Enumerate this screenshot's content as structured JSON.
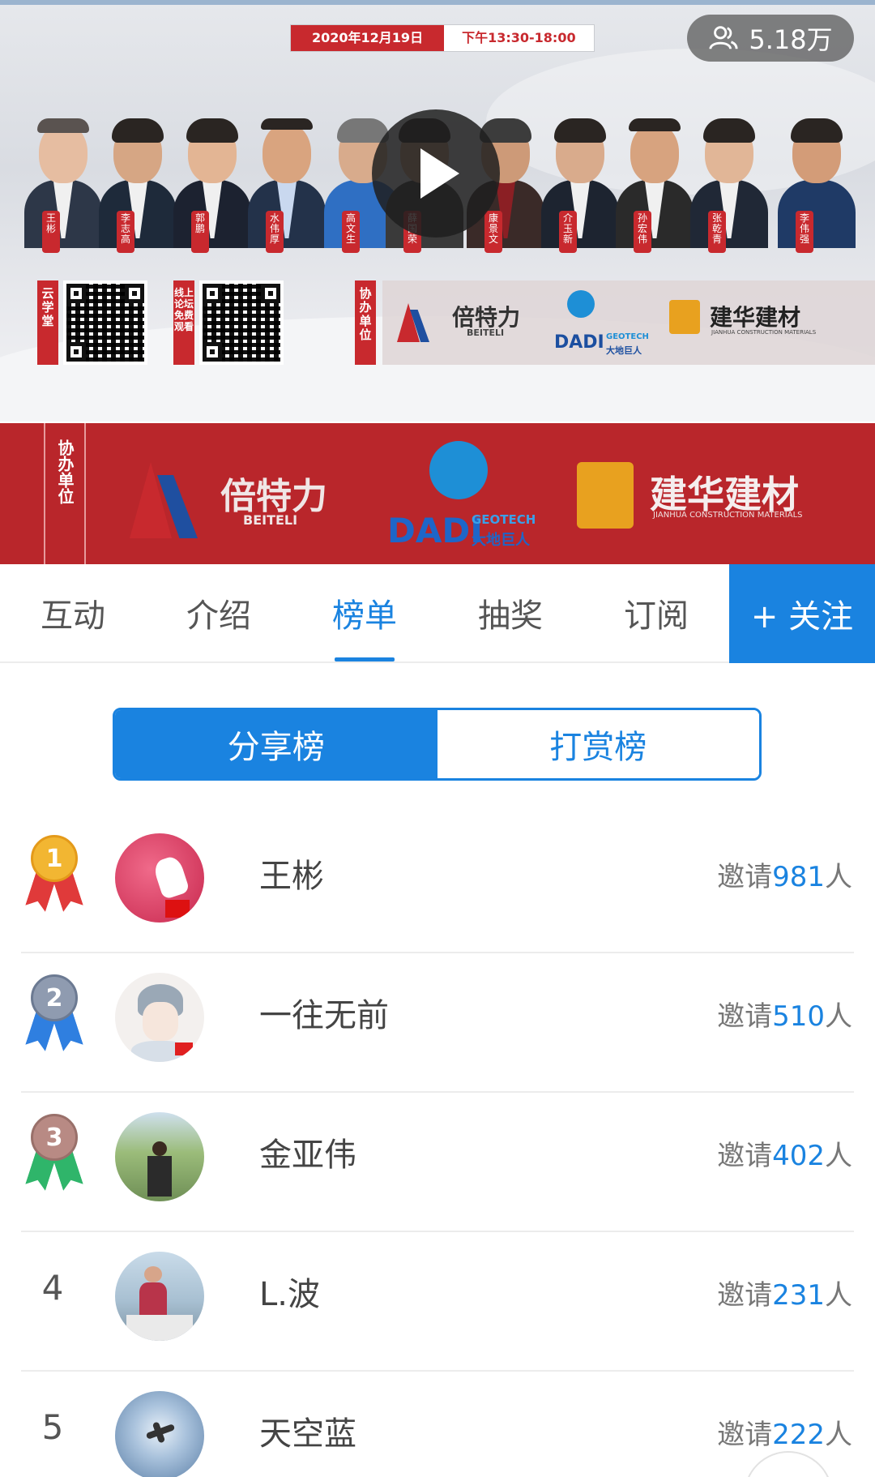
{
  "banner": {
    "date": "2020年12月19日",
    "time": "下午13:30-18:00",
    "viewers": "5.18万",
    "speakers": [
      "王彬",
      "李志高",
      "郭鹏",
      "水伟厚",
      "高文生",
      "薛国荣",
      "康景文",
      "介玉新",
      "孙宏伟",
      "张乾青",
      "李伟强"
    ],
    "cloud_label": "云学堂",
    "forum_label": "线上论坛 免费观看",
    "co_label": "协办单位",
    "sponsors": {
      "beiteli_cn": "倍特力",
      "beiteli_en": "BEITELI",
      "dadi_en": "DADI",
      "dadi_geo": "GEOTECH",
      "dadi_cn": "大地巨人",
      "jianhua_cn": "建华建材",
      "jianhua_en": "JIANHUA CONSTRUCTION MATERIALS"
    }
  },
  "tabs": [
    {
      "label": "互动"
    },
    {
      "label": "介绍"
    },
    {
      "label": "榜单"
    },
    {
      "label": "抽奖"
    },
    {
      "label": "订阅"
    }
  ],
  "follow_label": "+ 关注",
  "segment": {
    "share": "分享榜",
    "reward": "打赏榜"
  },
  "ranking": [
    {
      "rank": "1",
      "name": "王彬",
      "prefix": "邀请",
      "count": "981",
      "suffix": "人"
    },
    {
      "rank": "2",
      "name": "一往无前",
      "prefix": "邀请",
      "count": "510",
      "suffix": "人"
    },
    {
      "rank": "3",
      "name": "金亚伟",
      "prefix": "邀请",
      "count": "402",
      "suffix": "人"
    },
    {
      "rank": "4",
      "name": "L.波",
      "prefix": "邀请",
      "count": "231",
      "suffix": "人"
    },
    {
      "rank": "5",
      "name": "天空蓝",
      "prefix": "邀请",
      "count": "222",
      "suffix": "人"
    }
  ],
  "colors": {
    "accent": "#1a83e0",
    "brand_red": "#c8292e",
    "gold": "#f2b632",
    "silver": "#8f9bb0",
    "bronze": "#b88a84"
  }
}
